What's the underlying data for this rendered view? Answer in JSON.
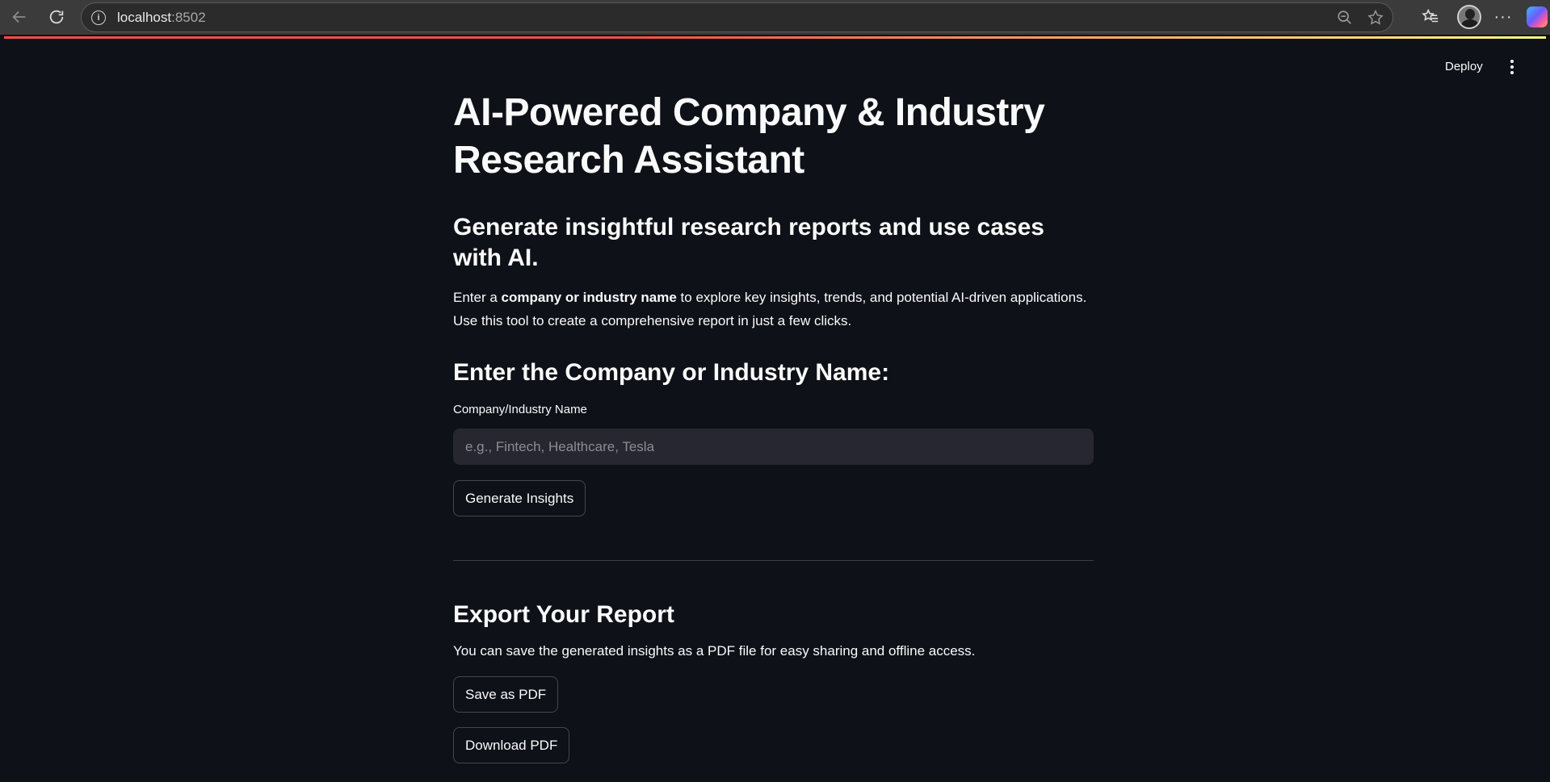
{
  "browser": {
    "url_host": "localhost",
    "url_port": ":8502"
  },
  "header": {
    "deploy_label": "Deploy"
  },
  "main": {
    "title": "AI-Powered Company & Industry Research Assistant",
    "subtitle": "Generate insightful research reports and use cases with AI.",
    "intro": {
      "prefix": "Enter a ",
      "bold": "company or industry name",
      "suffix": " to explore key insights, trends, and potential AI-driven applications. Use this tool to create a comprehensive report in just a few clicks."
    },
    "input_section_heading": "Enter the Company or Industry Name:",
    "input_label": "Company/Industry Name",
    "input_placeholder": "e.g., Fintech, Healthcare, Tesla",
    "generate_button": "Generate Insights",
    "export_heading": "Export Your Report",
    "export_text": "You can save the generated insights as a PDF file for easy sharing and offline access.",
    "save_pdf_button": "Save as PDF",
    "download_pdf_button": "Download PDF"
  },
  "colors": {
    "background": "#0e1117",
    "input_bg": "#262730",
    "accent": "#ff4b4b"
  }
}
